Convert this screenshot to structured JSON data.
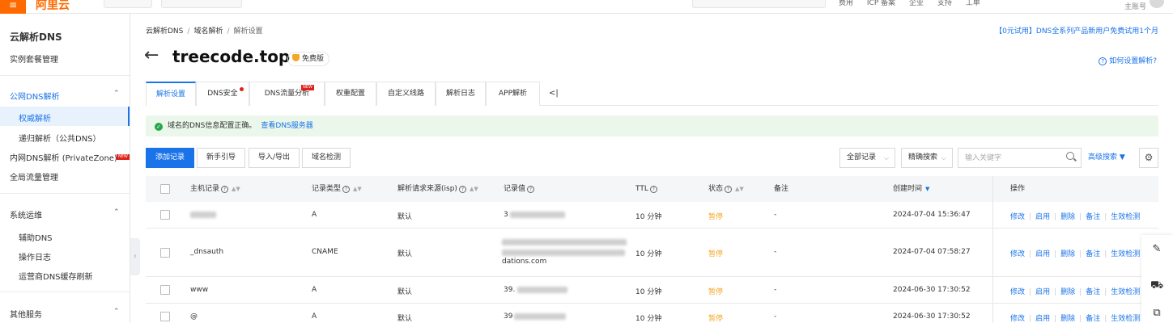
{
  "topbar": {
    "menu_icon": "≡",
    "logo": "阿里云",
    "links": [
      "费用",
      "ICP 备案",
      "企业",
      "支持",
      "工单"
    ],
    "account_label": "主账号"
  },
  "sidebar": {
    "title": "云解析DNS",
    "instance_mgmt": "实例套餐管理",
    "group_public": "公网DNS解析",
    "authoritative": "权威解析",
    "recursive": "递归解析（公共DNS）",
    "private_zone": "内网DNS解析 (PrivateZone)",
    "private_zone_badge": "NEW",
    "global_traffic": "全局流量管理",
    "group_ops": "系统运维",
    "aux_dns": "辅助DNS",
    "op_log": "操作日志",
    "isp_flush": "运营商DNS缓存刷新",
    "group_other": "其他服务"
  },
  "breadcrumb": {
    "root": "云解析DNS",
    "mid": "域名解析",
    "current": "解析设置"
  },
  "promo": "【0元试用】DNS全系列产品新用户免费试用1个月",
  "help_link": "如何设置解析?",
  "domain": {
    "name": "treecode.top",
    "edition": "免费版"
  },
  "tabs": [
    {
      "label": "解析设置"
    },
    {
      "label": "DNS安全"
    },
    {
      "label": "DNS流量分析",
      "badge": "NEW"
    },
    {
      "label": "权重配置"
    },
    {
      "label": "自定义线路"
    },
    {
      "label": "解析日志"
    },
    {
      "label": "APP解析"
    }
  ],
  "tabs_more": "<|",
  "alert": {
    "message": "域名的DNS信息配置正确。",
    "link": "查看DNS服务器"
  },
  "toolbar": {
    "add_record": "添加记录",
    "guide": "新手引导",
    "import_export": "导入/导出",
    "domain_check": "域名检测",
    "record_filter": "全部记录",
    "precise_search": "精确搜索",
    "search_placeholder": "输入关键字",
    "advanced_search": "高级搜索 ▼"
  },
  "table": {
    "columns": {
      "host": "主机记录",
      "type": "记录类型",
      "isp": "解析请求来源(isp)",
      "value": "记录值",
      "ttl": "TTL",
      "status": "状态",
      "remark": "备注",
      "created": "创建时间",
      "actions": "操作"
    },
    "rows": [
      {
        "host": "",
        "type": "A",
        "isp": "默认",
        "value_prefix": "3",
        "value_tail": "",
        "ttl": "10 分钟",
        "status": "暂停",
        "remark": "-",
        "created": "2024-07-04 15:36:47"
      },
      {
        "host": "_dnsauth",
        "type": "CNAME",
        "isp": "默认",
        "value_prefix": "",
        "value_tail": "dations.com",
        "ttl": "10 分钟",
        "status": "暂停",
        "remark": "-",
        "created": "2024-07-04 07:58:27"
      },
      {
        "host": "www",
        "type": "A",
        "isp": "默认",
        "value_prefix": "39.",
        "value_tail": "",
        "ttl": "10 分钟",
        "status": "暂停",
        "remark": "-",
        "created": "2024-06-30 17:30:52"
      },
      {
        "host": "@",
        "type": "A",
        "isp": "默认",
        "value_prefix": "39",
        "value_tail": "",
        "ttl": "10 分钟",
        "status": "暂停",
        "remark": "-",
        "created": "2024-06-30 17:30:52"
      }
    ],
    "actions": [
      "修改",
      "启用",
      "删除",
      "备注",
      "生效检测"
    ]
  },
  "colors": {
    "accent": "#1a73e8",
    "brand": "#ff6a00",
    "paused": "#f5a623",
    "success": "#26a74a"
  }
}
